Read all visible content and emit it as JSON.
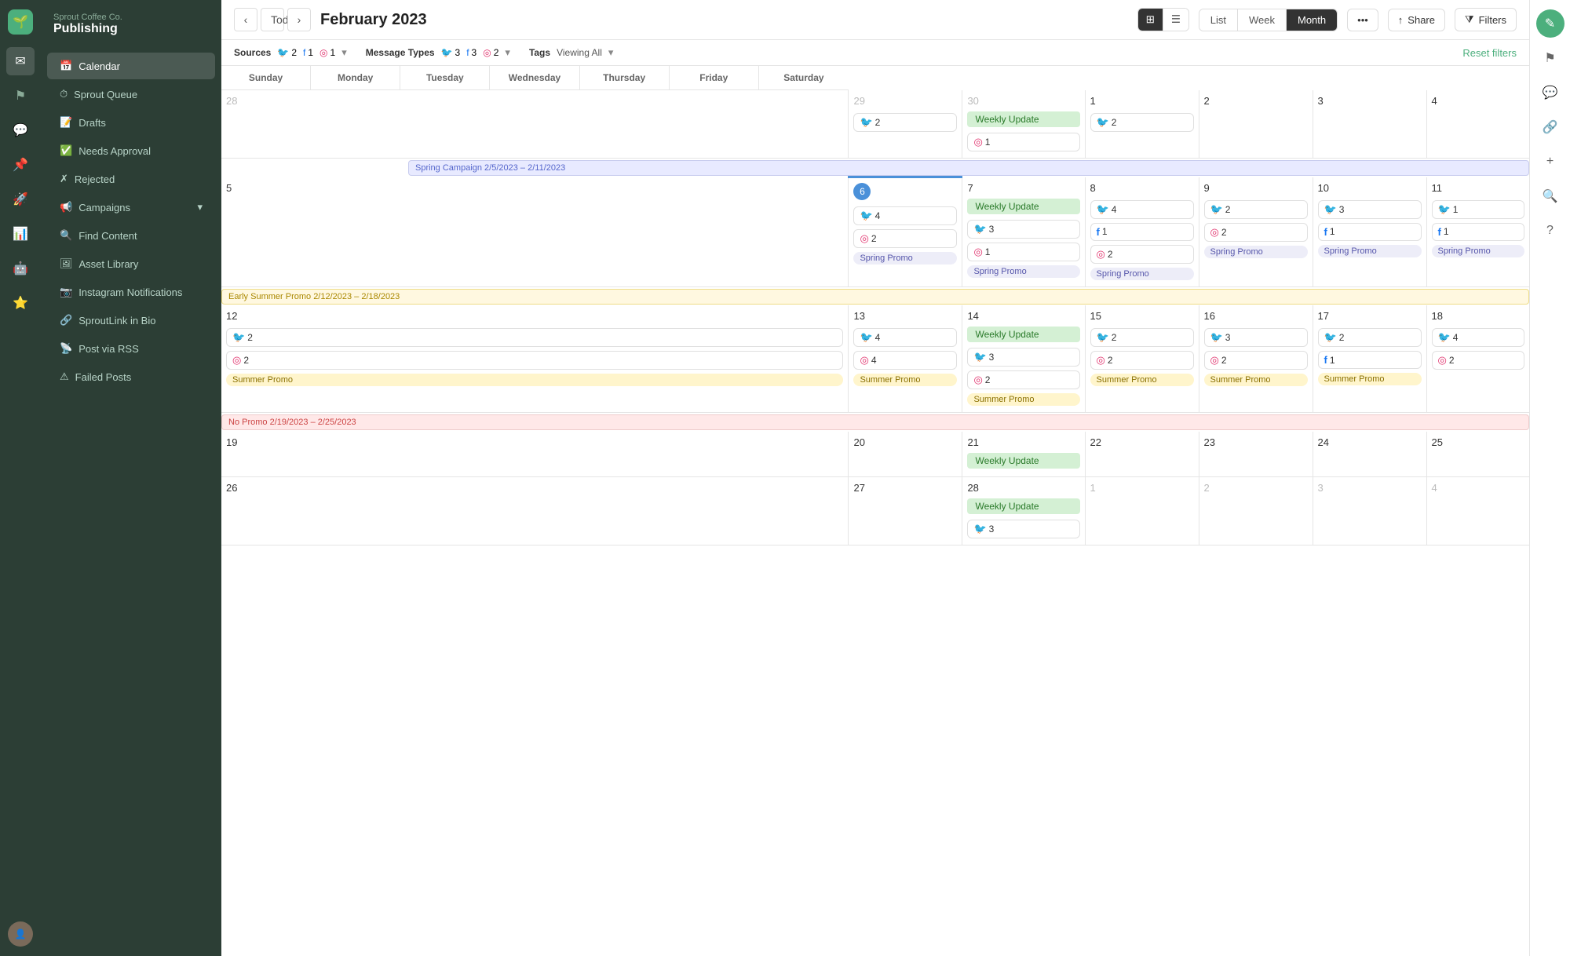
{
  "app": {
    "company": "Sprout Coffee Co.",
    "product": "Publishing"
  },
  "toolbar": {
    "today_label": "Today",
    "month_title": "February 2023",
    "view_compact": "⊞",
    "view_list_icon": "☰",
    "list_label": "List",
    "week_label": "Week",
    "month_label": "Month",
    "more_label": "•••",
    "share_label": "Share",
    "filters_label": "Filters"
  },
  "filters": {
    "sources_label": "Sources",
    "sources_twitter": "2",
    "sources_facebook": "1",
    "sources_instagram": "1",
    "message_types_label": "Message Types",
    "mt_twitter": "3",
    "mt_facebook": "3",
    "mt_instagram": "2",
    "tags_label": "Tags",
    "tags_value": "Viewing All",
    "reset_label": "Reset filters"
  },
  "nav": {
    "calendar": "Calendar",
    "sprout_queue": "Sprout Queue",
    "drafts": "Drafts",
    "needs_approval": "Needs Approval",
    "rejected": "Rejected",
    "campaigns": "Campaigns",
    "find_content": "Find Content",
    "asset_library": "Asset Library",
    "instagram_notifications": "Instagram Notifications",
    "sproutlink": "SproutLink in Bio",
    "post_via_rss": "Post via RSS",
    "failed_posts": "Failed Posts"
  },
  "calendar": {
    "days": [
      "Sunday",
      "Monday",
      "Tuesday",
      "Wednesday",
      "Thursday",
      "Friday",
      "Saturday"
    ],
    "campaigns": {
      "spring": "Spring Campaign 2/5/2023 – 2/11/2023",
      "summer": "Early Summer Promo 2/12/2023 – 2/18/2023",
      "nopromo": "No Promo 2/19/2023 – 2/25/2023"
    },
    "weeks": [
      {
        "id": "week1",
        "days": [
          {
            "date": "28",
            "other": true,
            "posts": []
          },
          {
            "date": "29",
            "other": true,
            "posts": [
              {
                "type": "twitter",
                "count": "2"
              }
            ]
          },
          {
            "date": "30",
            "other": true,
            "posts": [
              {
                "type": "instagram",
                "count": "1"
              }
            ],
            "tag": "Weekly Update"
          },
          {
            "date": "1",
            "posts": [
              {
                "type": "twitter",
                "count": "2"
              }
            ]
          },
          {
            "date": "2",
            "posts": []
          },
          {
            "date": "3",
            "posts": []
          },
          {
            "date": "4",
            "posts": []
          }
        ]
      },
      {
        "id": "week2",
        "campaign": "spring",
        "days": [
          {
            "date": "5",
            "posts": []
          },
          {
            "date": "6",
            "today": true,
            "posts": [
              {
                "type": "twitter",
                "count": "4"
              },
              {
                "type": "instagram",
                "count": "2"
              }
            ],
            "promo": "Spring Promo"
          },
          {
            "date": "7",
            "posts": [
              {
                "type": "twitter",
                "count": "3"
              },
              {
                "type": "instagram",
                "count": "1"
              }
            ],
            "tag": "Weekly Update",
            "promo": "Spring Promo"
          },
          {
            "date": "8",
            "posts": [
              {
                "type": "twitter",
                "count": "4"
              },
              {
                "type": "facebook",
                "count": "1"
              },
              {
                "type": "instagram",
                "count": "2"
              }
            ],
            "promo": "Spring Promo"
          },
          {
            "date": "9",
            "posts": [
              {
                "type": "twitter",
                "count": "2"
              },
              {
                "type": "instagram",
                "count": "2"
              }
            ],
            "promo": "Spring Promo"
          },
          {
            "date": "10",
            "posts": [
              {
                "type": "twitter",
                "count": "3"
              },
              {
                "type": "facebook",
                "count": "1"
              }
            ],
            "promo": "Spring Promo"
          },
          {
            "date": "11",
            "posts": [
              {
                "type": "twitter",
                "count": "1"
              },
              {
                "type": "facebook",
                "count": "1"
              }
            ],
            "promo": "Spring Promo"
          }
        ]
      },
      {
        "id": "week3",
        "campaign": "summer",
        "days": [
          {
            "date": "12",
            "posts": [
              {
                "type": "twitter",
                "count": "2"
              },
              {
                "type": "instagram",
                "count": "2"
              }
            ],
            "promo": "Summer Promo"
          },
          {
            "date": "13",
            "posts": [
              {
                "type": "twitter",
                "count": "4"
              },
              {
                "type": "instagram",
                "count": "4"
              }
            ],
            "promo": "Summer Promo"
          },
          {
            "date": "14",
            "posts": [
              {
                "type": "twitter",
                "count": "3"
              },
              {
                "type": "instagram",
                "count": "2"
              }
            ],
            "tag": "Weekly Update",
            "promo": "Summer Promo"
          },
          {
            "date": "15",
            "posts": [
              {
                "type": "twitter",
                "count": "2"
              },
              {
                "type": "instagram",
                "count": "2"
              }
            ],
            "promo": "Summer Promo"
          },
          {
            "date": "16",
            "posts": [
              {
                "type": "twitter",
                "count": "3"
              },
              {
                "type": "instagram",
                "count": "2"
              }
            ],
            "promo": "Summer Promo"
          },
          {
            "date": "17",
            "posts": [
              {
                "type": "twitter",
                "count": "2"
              },
              {
                "type": "facebook",
                "count": "1"
              }
            ],
            "promo": "Summer Promo"
          },
          {
            "date": "18",
            "posts": [
              {
                "type": "twitter",
                "count": "4"
              },
              {
                "type": "instagram",
                "count": "2"
              }
            ]
          }
        ]
      },
      {
        "id": "week4",
        "campaign": "nopromo",
        "days": [
          {
            "date": "19",
            "posts": []
          },
          {
            "date": "20",
            "posts": []
          },
          {
            "date": "21",
            "posts": [],
            "tag": "Weekly Update"
          },
          {
            "date": "22",
            "posts": []
          },
          {
            "date": "23",
            "posts": []
          },
          {
            "date": "24",
            "posts": []
          },
          {
            "date": "25",
            "posts": []
          }
        ]
      },
      {
        "id": "week5",
        "days": [
          {
            "date": "26",
            "posts": []
          },
          {
            "date": "27",
            "posts": []
          },
          {
            "date": "28",
            "posts": [],
            "tag": "Weekly Update"
          },
          {
            "date": "1",
            "other": true,
            "posts": []
          },
          {
            "date": "2",
            "other": true,
            "posts": []
          },
          {
            "date": "3",
            "other": true,
            "posts": []
          },
          {
            "date": "4",
            "other": true,
            "posts": []
          }
        ]
      }
    ]
  }
}
